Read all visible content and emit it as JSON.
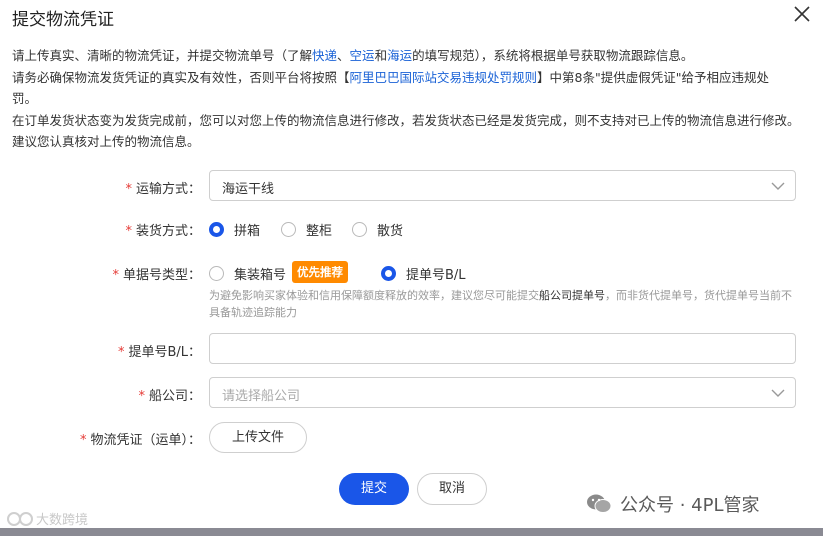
{
  "dialog": {
    "title": "提交物流凭证"
  },
  "notice": {
    "line1_pre": "请上传真实、清晰的物流凭证，并提交物流单号（了解",
    "link_express": "快递",
    "sep1": "、",
    "link_air": "空运",
    "and": "和",
    "link_sea": "海运",
    "line1_post": "的填写规范），系统将根据单号获取物流跟踪信息。",
    "line2_pre": "请务必确保物流发货凭证的真实及有效性，否则平台将按照【",
    "link_rules": "阿里巴巴国际站交易违规处罚规则",
    "line2_post": "】中第8条\"提供虚假凭证\"给予相应违规处罚。",
    "line3": "在订单发货状态变为发货完成前，您可以对您上传的物流信息进行修改，若发货状态已经是发货完成，则不支持对已上传的物流信息进行修改。建议您认真核对上传的物流信息。"
  },
  "form": {
    "required_mark": "*",
    "shipping_method": {
      "label": "运输方式：",
      "value": "海运干线"
    },
    "loading_method": {
      "label": "装货方式：",
      "options": [
        "拼箱",
        "整柜",
        "散货"
      ],
      "selected": "拼箱"
    },
    "doc_type": {
      "label": "单据号类型：",
      "option_container": "集装箱号",
      "badge": "优先推荐",
      "option_bl": "提单号B/L",
      "selected": "提单号B/L",
      "hint_pre": "为避免影响买家体验和信用保障额度释放的效率，建议您尽可能提交",
      "hint_bold": "船公司提单号",
      "hint_post": "，而非货代提单号，货代提单号当前不具备轨迹追踪能力"
    },
    "bl_number": {
      "label": "提单号B/L：",
      "value": ""
    },
    "shipping_company": {
      "label": "船公司：",
      "placeholder": "请选择船公司"
    },
    "voucher": {
      "label": "物流凭证（运单）：",
      "upload_label": "上传文件"
    }
  },
  "actions": {
    "submit": "提交",
    "cancel": "取消"
  },
  "watermarks": {
    "left": "大数跨境",
    "right": "公众号 · 4PL管家"
  },
  "colors": {
    "primary": "#1a56e8",
    "link": "#1a62d6",
    "badge": "#ff8a00",
    "required": "#e53935"
  }
}
